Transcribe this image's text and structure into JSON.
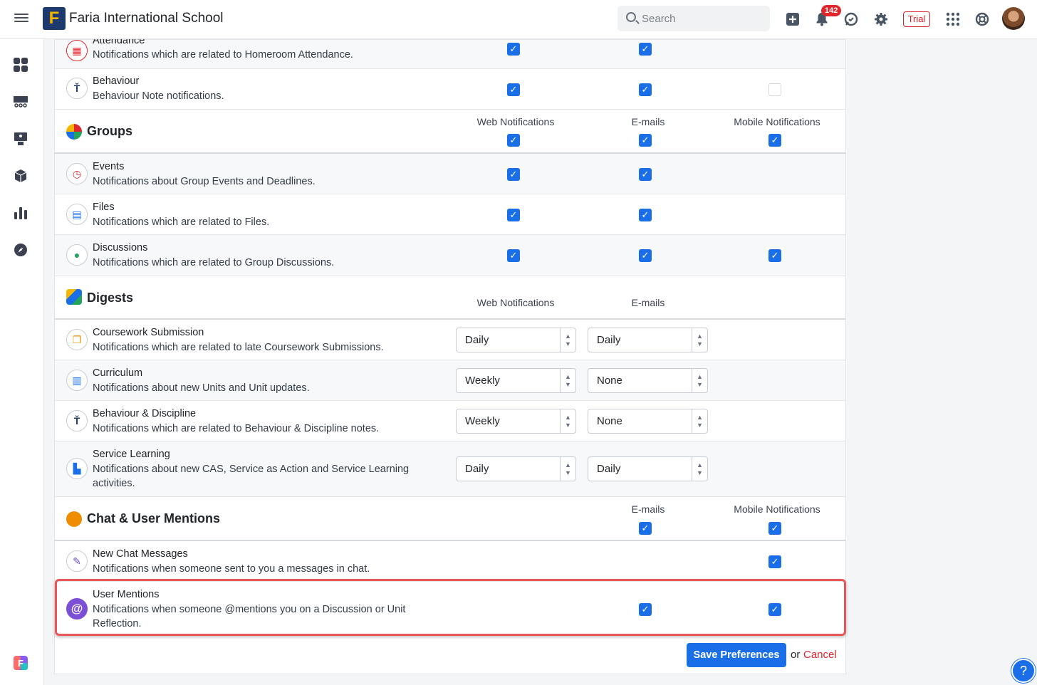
{
  "header": {
    "logo_letter": "F",
    "school_name": "Faria International School",
    "search_placeholder": "Search",
    "notification_count": "142",
    "trial_label": "Trial"
  },
  "sidebar": {
    "items": [
      "dashboard-icon",
      "classes-icon",
      "teaching-icon",
      "cube-icon",
      "reports-icon",
      "compass-icon"
    ],
    "bottom_logo": "F"
  },
  "sections": {
    "top_rows": [
      {
        "title": "Attendance",
        "desc": "Notifications which are related to Homeroom Attendance.",
        "web": true,
        "email": true,
        "mobile": null
      },
      {
        "title": "Behaviour",
        "desc": "Behaviour Note notifications.",
        "web": true,
        "email": true,
        "mobile": false
      }
    ],
    "groups": {
      "title": "Groups",
      "col_web": "Web Notifications",
      "col_email": "E-mails",
      "col_mobile": "Mobile Notifications",
      "rows": [
        {
          "title": "Events",
          "desc": "Notifications about Group Events and Deadlines.",
          "web": true,
          "email": true,
          "mobile": null
        },
        {
          "title": "Files",
          "desc": "Notifications which are related to Files.",
          "web": true,
          "email": true,
          "mobile": null
        },
        {
          "title": "Discussions",
          "desc": "Notifications which are related to Group Discussions.",
          "web": true,
          "email": true,
          "mobile": true
        }
      ]
    },
    "digests": {
      "title": "Digests",
      "col_web": "Web Notifications",
      "col_email": "E-mails",
      "rows": [
        {
          "title": "Coursework Submission",
          "desc": "Notifications which are related to late Coursework Submissions.",
          "web": "Daily",
          "email": "Daily"
        },
        {
          "title": "Curriculum",
          "desc": "Notifications about new Units and Unit updates.",
          "web": "Weekly",
          "email": "None"
        },
        {
          "title": "Behaviour & Discipline",
          "desc": "Notifications which are related to Behaviour & Discipline notes.",
          "web": "Weekly",
          "email": "None"
        },
        {
          "title": "Service Learning",
          "desc": "Notifications about new CAS, Service as Action and Service Learning activities.",
          "web": "Daily",
          "email": "Daily"
        }
      ]
    },
    "chat": {
      "title": "Chat & User Mentions",
      "col_email": "E-mails",
      "col_mobile": "Mobile Notifications",
      "rows": [
        {
          "title": "New Chat Messages",
          "desc": "Notifications when someone sent to you a messages in chat.",
          "email": null,
          "mobile": true
        },
        {
          "title": "User Mentions",
          "desc": "Notifications when someone @mentions you on a Discussion or Unit Reflection.",
          "email": true,
          "mobile": true
        }
      ]
    }
  },
  "footer": {
    "save_label": "Save Preferences",
    "or_label": "or",
    "cancel_label": "Cancel"
  },
  "colors": {
    "accent": "#1a6fe8",
    "danger": "#e0262c",
    "highlight": "#e8585b"
  }
}
